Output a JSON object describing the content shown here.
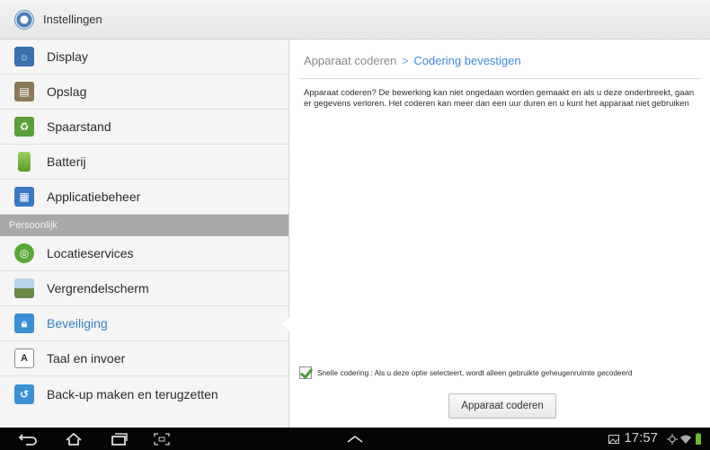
{
  "app": {
    "title": "Instellingen",
    "icon": "settings-icon"
  },
  "menu": {
    "items_top": [
      {
        "label": "Display",
        "icon": "display-icon",
        "color": "#3a6fb0"
      },
      {
        "label": "Opslag",
        "icon": "storage-icon",
        "color": "#8a7a5a"
      },
      {
        "label": "Spaarstand",
        "icon": "power-saving-icon",
        "color": "#5aa03a"
      },
      {
        "label": "Batterij",
        "icon": "battery-icon",
        "color": "#76b83a"
      },
      {
        "label": "Applicatiebeheer",
        "icon": "app-manager-icon",
        "color": "#3a78c4"
      }
    ],
    "section_header": "Persoonlijk",
    "items_bottom": [
      {
        "label": "Locatieservices",
        "icon": "location-icon",
        "color": "#5aa83a"
      },
      {
        "label": "Vergrendelscherm",
        "icon": "lock-screen-icon",
        "color": "#6a8a4a"
      },
      {
        "label": "Beveiliging",
        "icon": "security-icon",
        "color": "#3a8fd6",
        "active": true
      },
      {
        "label": "Taal en invoer",
        "icon": "language-icon",
        "color": "#ffffff"
      },
      {
        "label": "Back-up maken en terugzetten",
        "icon": "backup-icon",
        "color": "#3a8fd6"
      }
    ]
  },
  "pane": {
    "breadcrumb_parent": "Apparaat coderen",
    "breadcrumb_separator": ">",
    "breadcrumb_current": "Codering bevestigen",
    "description": "Apparaat coderen? De bewerking kan niet ongedaan worden gemaakt en als u deze onderbreekt, gaan er gegevens verloren. Het coderen kan meer dan een uur duren en u kunt het apparaat niet gebruiken",
    "option_label": "Snelle codering : Als u deze optie selecteert, wordt alleen gebruikte geheugenruimte gecodeerd",
    "option_checked": true,
    "encrypt_button": "Apparaat coderen"
  },
  "system_bar": {
    "clock": "17:57",
    "nav_icons": [
      "back-icon",
      "home-icon",
      "recent-apps-icon",
      "screenshot-icon",
      "expand-up-icon"
    ],
    "status_icons": [
      "notification-image-icon",
      "usb-icon",
      "wifi-icon",
      "battery-status-icon"
    ]
  }
}
